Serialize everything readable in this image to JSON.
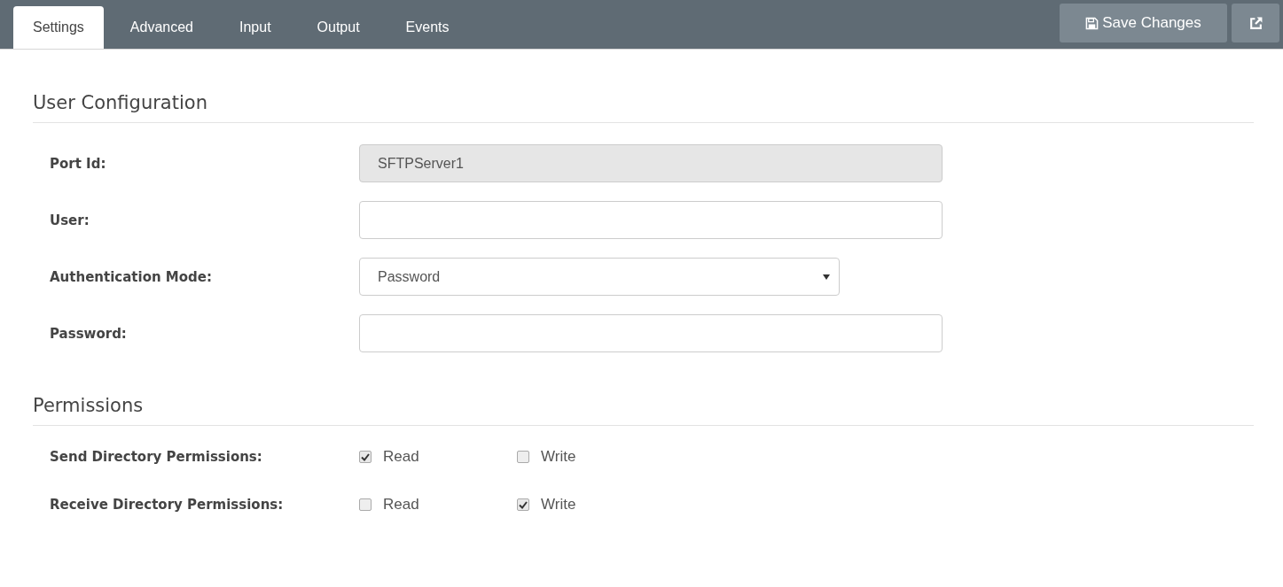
{
  "tabs": [
    {
      "label": "Settings",
      "selected": true
    },
    {
      "label": "Advanced",
      "selected": false
    },
    {
      "label": "Input",
      "selected": false
    },
    {
      "label": "Output",
      "selected": false
    },
    {
      "label": "Events",
      "selected": false
    }
  ],
  "toolbar": {
    "save_button": "Save Changes"
  },
  "sections": [
    {
      "title": "User Configuration",
      "kind": "fields",
      "fields": [
        {
          "label": "Port Id:",
          "kind": "text",
          "value": "SFTPServer1",
          "disabled": true
        },
        {
          "label": "User:",
          "kind": "text",
          "disabled": false
        },
        {
          "label": "Authentication Mode:",
          "kind": "select",
          "value": "Password",
          "disabled": false
        },
        {
          "label": "Password:",
          "kind": "password",
          "disabled": false
        }
      ]
    },
    {
      "title": "Permissions",
      "kind": "checks",
      "rows": [
        {
          "label": "Send Directory Permissions:",
          "options": [
            {
              "label": "Read",
              "checked": true
            },
            {
              "label": "Write",
              "checked": false
            }
          ]
        },
        {
          "label": "Receive Directory Permissions:",
          "options": [
            {
              "label": "Read",
              "checked": false
            },
            {
              "label": "Write",
              "checked": true
            }
          ]
        }
      ]
    }
  ]
}
